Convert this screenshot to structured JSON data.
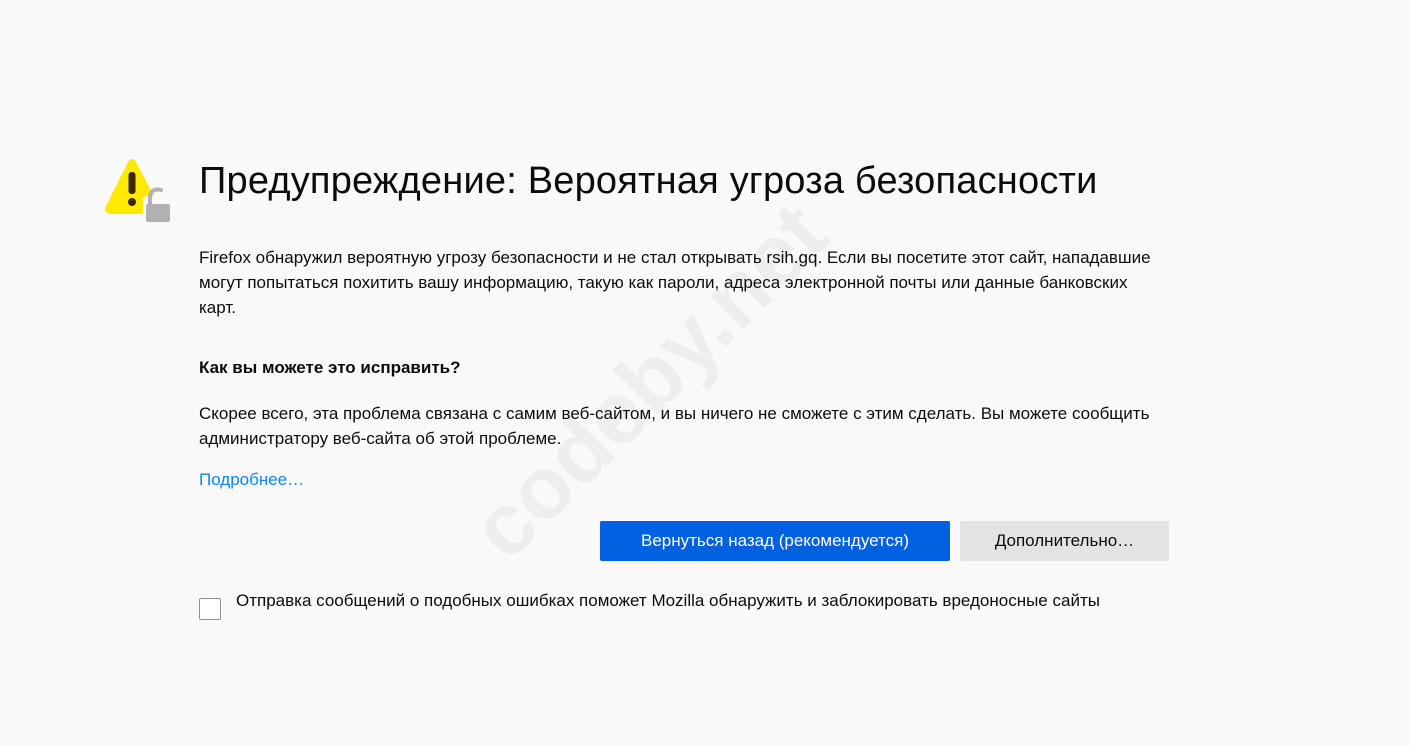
{
  "header": {
    "title": "Предупреждение: Вероятная угроза безопасности"
  },
  "icons": {
    "warning": "warning-triangle-icon",
    "lock": "broken-lock-icon"
  },
  "body": {
    "intro": "Firefox обнаружил вероятную угрозу безопасности и не стал открывать rsih.gq. Если вы посетите этот сайт, нападавшие могут попытаться похитить вашу информацию, такую как пароли, адреса электронной почты или данные банковских карт.",
    "subheading": "Как вы можете это исправить?",
    "advice": "Скорее всего, эта проблема связана с самим веб-сайтом, и вы ничего не сможете с этим сделать. Вы можете сообщить администратору веб-сайта об этой проблеме.",
    "learn_more": "Подробнее…"
  },
  "buttons": {
    "go_back": "Вернуться назад (рекомендуется)",
    "advanced": "Дополнительно…"
  },
  "report": {
    "checked": false,
    "label": "Отправка сообщений о подобных ошибках поможет Mozilla обнаружить и заблокировать вредоносные сайты"
  },
  "watermark": {
    "text": "codeby.net"
  },
  "colors": {
    "background": "#f9f9fa",
    "primary_button": "#0060df",
    "secondary_button": "#e3e3e6",
    "link": "#0a84ff",
    "warning_yellow": "#ffe900"
  }
}
